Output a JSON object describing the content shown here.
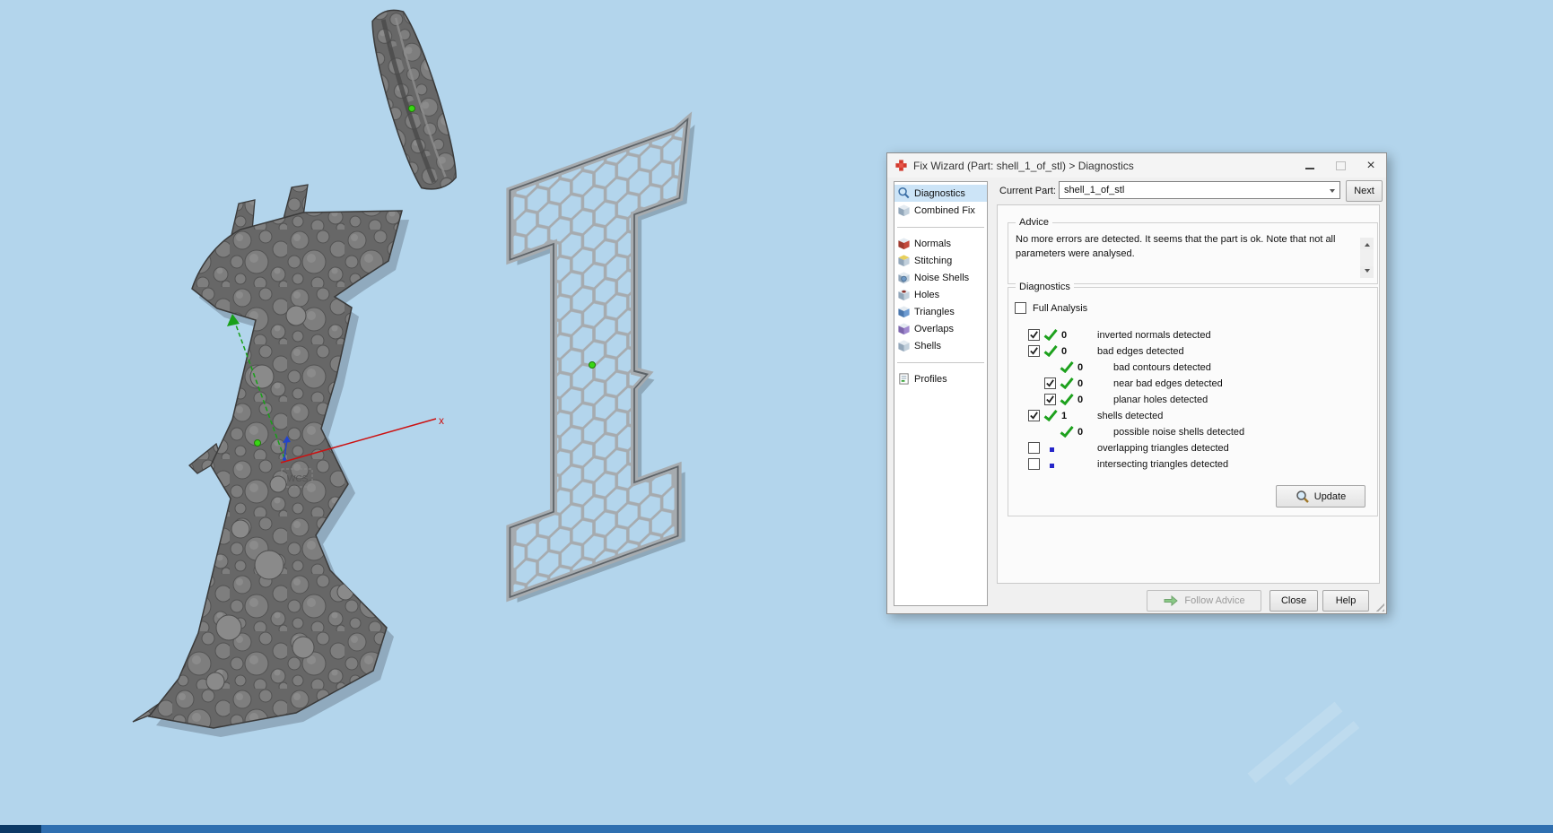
{
  "window": {
    "title": "Fix Wizard (Part: shell_1_of_stl) > Diagnostics"
  },
  "current_part": {
    "label": "Current Part:",
    "value": "shell_1_of_stl",
    "next_label": "Next"
  },
  "sidebar": {
    "items": [
      {
        "label": "Diagnostics",
        "icon": "magnifier-icon",
        "selected": true
      },
      {
        "label": "Combined Fix",
        "icon": "cube-icon",
        "selected": false
      },
      {
        "label": "Normals",
        "icon": "cube-icon",
        "selected": false
      },
      {
        "label": "Stitching",
        "icon": "cube-icon",
        "selected": false
      },
      {
        "label": "Noise Shells",
        "icon": "cube-sphere-icon",
        "selected": false
      },
      {
        "label": "Holes",
        "icon": "cube-hole-icon",
        "selected": false
      },
      {
        "label": "Triangles",
        "icon": "cube-icon",
        "selected": false
      },
      {
        "label": "Overlaps",
        "icon": "cube-icon",
        "selected": false
      },
      {
        "label": "Shells",
        "icon": "cube-icon",
        "selected": false
      },
      {
        "label": "Profiles",
        "icon": "page-icon",
        "selected": false
      }
    ]
  },
  "advice": {
    "title": "Advice",
    "text": "No more errors are detected. It seems that the part is ok. Note that not all parameters were analysed."
  },
  "diagnostics": {
    "title": "Diagnostics",
    "full_analysis_label": "Full Analysis",
    "full_analysis_checked": false,
    "update_label": "Update",
    "rows": [
      {
        "has_checkbox": true,
        "checked": true,
        "status": "check",
        "count": "0",
        "label": "inverted normals detected",
        "indent": 0
      },
      {
        "has_checkbox": true,
        "checked": true,
        "status": "check",
        "count": "0",
        "label": "bad edges detected",
        "indent": 0
      },
      {
        "has_checkbox": false,
        "checked": false,
        "status": "check",
        "count": "0",
        "label": "bad contours detected",
        "indent": 1
      },
      {
        "has_checkbox": true,
        "checked": true,
        "status": "check",
        "count": "0",
        "label": "near bad edges detected",
        "indent": 1
      },
      {
        "has_checkbox": true,
        "checked": true,
        "status": "check",
        "count": "0",
        "label": "planar holes detected",
        "indent": 1
      },
      {
        "has_checkbox": true,
        "checked": true,
        "status": "check",
        "count": "1",
        "label": "shells detected",
        "indent": 0
      },
      {
        "has_checkbox": false,
        "checked": false,
        "status": "check",
        "count": "0",
        "label": "possible noise shells detected",
        "indent": 1
      },
      {
        "has_checkbox": true,
        "checked": false,
        "status": "dot",
        "count": "",
        "label": "overlapping triangles detected",
        "indent": 0
      },
      {
        "has_checkbox": true,
        "checked": false,
        "status": "dot",
        "count": "",
        "label": "intersecting triangles detected",
        "indent": 0
      }
    ]
  },
  "footer": {
    "follow_advice_label": "Follow Advice",
    "close_label": "Close",
    "help_label": "Help"
  },
  "viewport": {
    "wcs_label": "WCS",
    "x_axis_label": "x"
  },
  "colors": {
    "viewport_background": "#b3d5ec",
    "axis_x": "#cc1111",
    "axis_y": "#18a018",
    "axis_z": "#2244cc",
    "check_green": "#1da11d",
    "dot_blue": "#2626c9",
    "selection_blue": "#cce4f7",
    "part_gray_dark": "#6b6b6b",
    "part_gray_light": "#a6abaf"
  }
}
